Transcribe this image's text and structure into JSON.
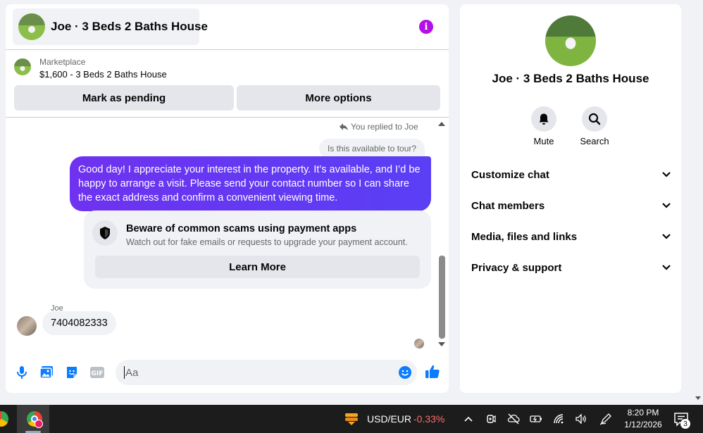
{
  "chat": {
    "title": "Joe · 3 Beds 2 Baths House",
    "marketplace_label": "Marketplace",
    "listing": "$1,600 - 3 Beds 2 Baths House",
    "mark_pending": "Mark as pending",
    "more_options": "More options"
  },
  "messages": {
    "replied_label": "You replied to Joe",
    "quoted": "Is this available to tour?",
    "my_message": "Good day! I appreciate your interest in the property. It’s available, and I’d be happy to arrange a visit. Please send your contact number so I can share the exact address and confirm a convenient viewing time.",
    "scam_title": "Beware of common scams using payment apps",
    "scam_desc": "Watch out for fake emails or requests to upgrade your payment account.",
    "learn_more": "Learn More",
    "sender": "Joe",
    "their_message": "7404082333"
  },
  "composer": {
    "placeholder": "Aa",
    "icons": [
      "microphone-icon",
      "image-icon",
      "sticker-icon",
      "gif-icon",
      "emoji-icon",
      "thumbs-up-icon"
    ]
  },
  "info_panel": {
    "name": "Joe · 3 Beds 2 Baths House",
    "actions": [
      {
        "label": "Mute",
        "icon": "bell-icon"
      },
      {
        "label": "Search",
        "icon": "search-icon"
      }
    ],
    "sections": [
      {
        "label": "Customize chat"
      },
      {
        "label": "Chat members"
      },
      {
        "label": "Media, files and links"
      },
      {
        "label": "Privacy & support"
      }
    ]
  },
  "taskbar": {
    "stock_pair": "USD/EUR",
    "stock_change": "-0.33%",
    "time": "8:20 PM",
    "date": "1/12/2026",
    "notification_count": "3"
  },
  "colors": {
    "accent_purple": "#b50fe7",
    "bubble_gradient_start": "#6e32f0",
    "bubble_gradient_end": "#5a3ff5",
    "messenger_blue": "#0a7cff",
    "stock_negative": "#ff6b6b"
  }
}
